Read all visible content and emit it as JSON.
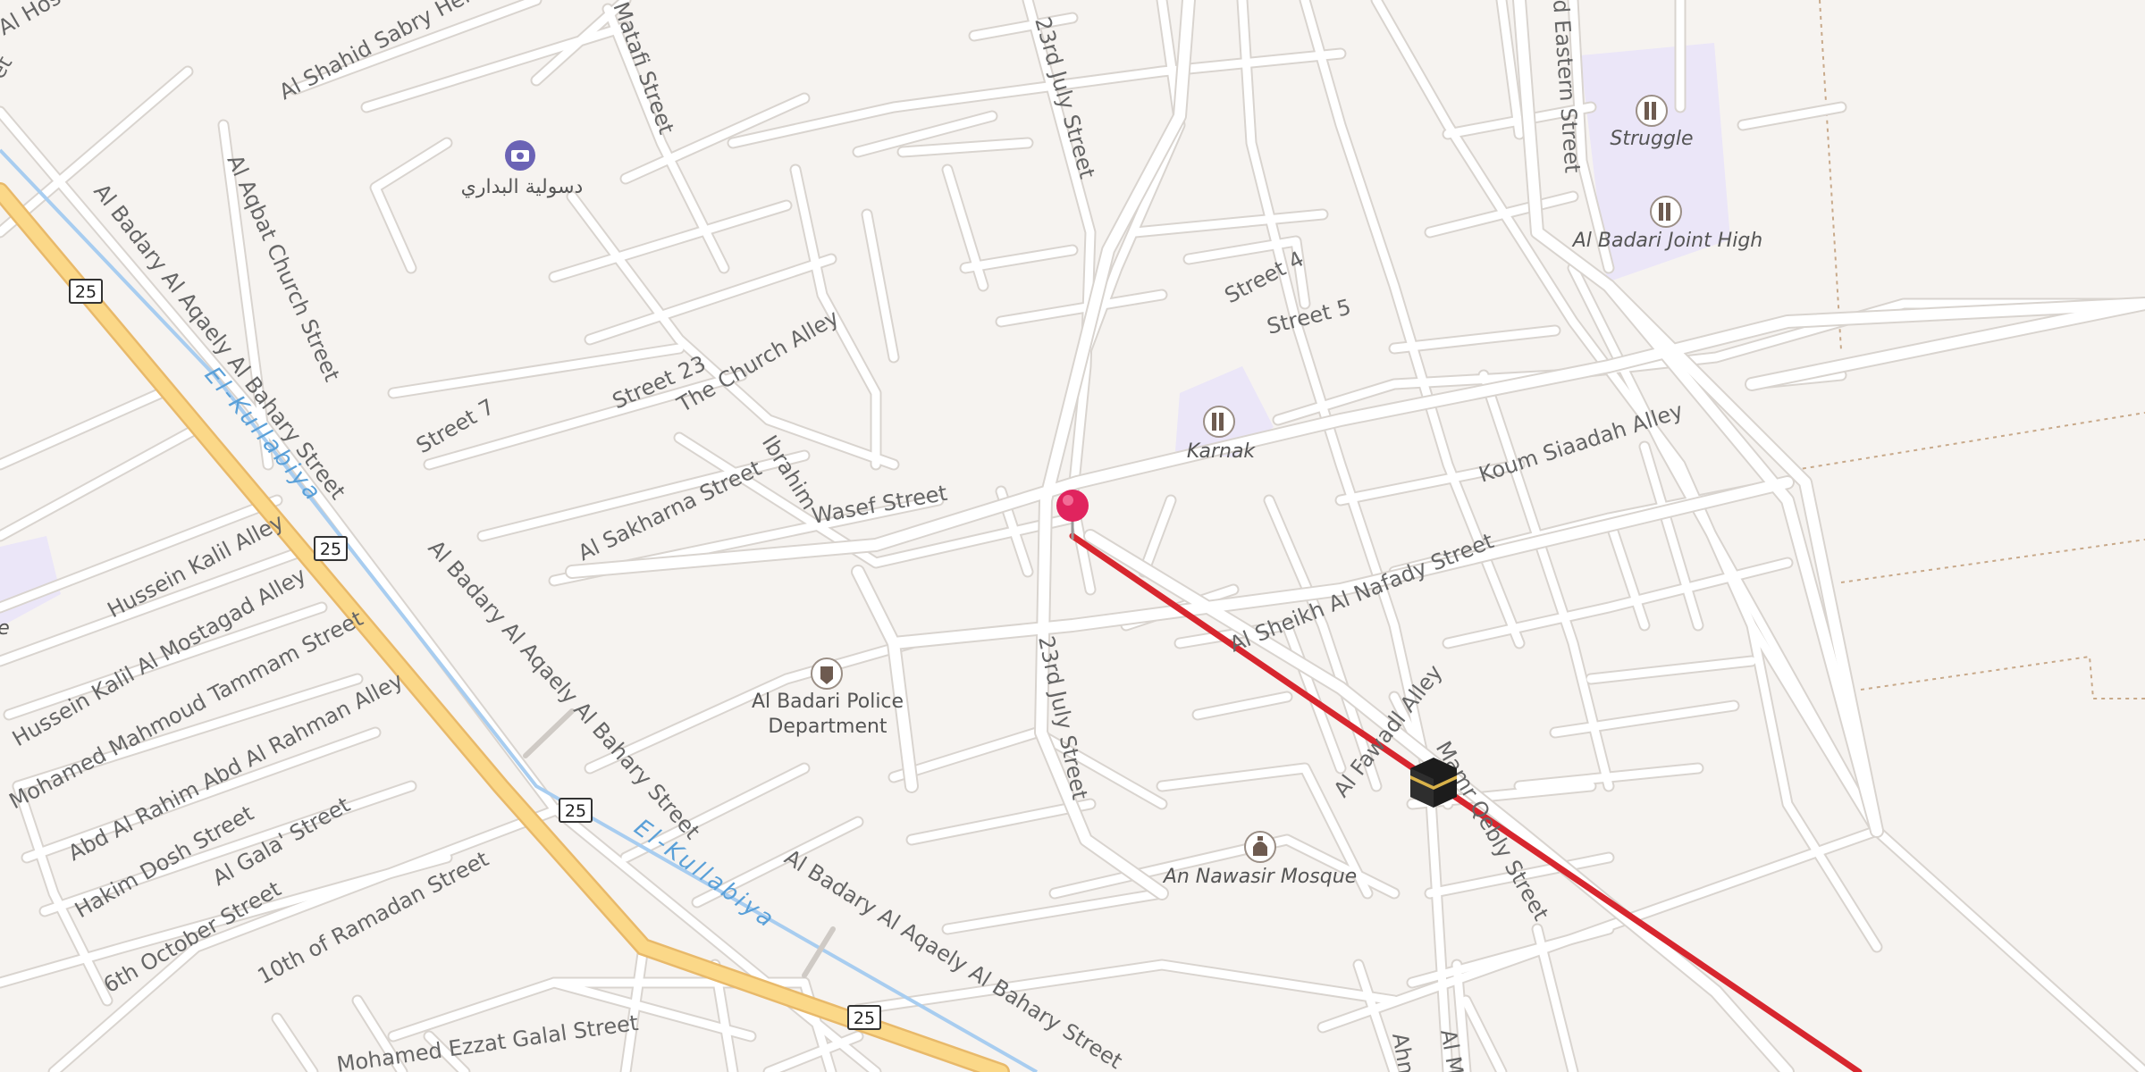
{
  "colors": {
    "background": "#f6f3f0",
    "road": "#ffffff",
    "road_casing": "#d9d4cf",
    "highway": "#fbd888",
    "highway_casing": "#e8b96a",
    "water": "#a8cdf0",
    "school_area": "#ebe6f8",
    "route_line": "#d7262e",
    "pin": "#e0245e",
    "boundary": "#c8a98a"
  },
  "streets": {
    "shahid_sabry": "Al Shahid Sabry Henry Street",
    "al_hos": "Al Hos",
    "matafi": "Matafi Street",
    "july23_north": "23rd July Street",
    "eastern": "d Eastern Street",
    "badary_aqaely_1": "Al Badary Al Aqaely Al Bahary Street",
    "aqbat_church": "Al Aqbat Church Street",
    "street4": "Street 4",
    "street5": "Street 5",
    "church_alley": "The Church Alley",
    "street23": "Street 23",
    "street7": "Street 7",
    "ibrahim_wasef_a": "Ibrahim",
    "ibrahim_wasef_b": "Wasef Street",
    "sakharna": "Al Sakharna Street",
    "koum_siaadah": "Koum Siaadah Alley",
    "sheikh_nafady": "Al Sheikh Al Nafady Street",
    "hussein_kalil": "Hussein Kalil Alley",
    "hussein_kalil_mostagad": "Hussein Kalil Al Mostagad Alley",
    "mohamed_tammam": "Mohamed Mahmoud Tammam Street",
    "abd_rahim": "Abd Al Rahim Abd Al Rahman Alley",
    "hakim_dosh": "Hakim Dosh Street",
    "gala": "Al Gala' Street",
    "october6": "6th October Street",
    "ramadan10": "10th of Ramadan Street",
    "badary_aqaely_2": "Al Badary Al Aqaely Al Bahary Street",
    "badary_aqaely_3": "Al Badary Al Aqaely Al Bahary Street",
    "july23_south": "23rd July Street",
    "fawadi": "Al Fawadl Alley",
    "qebly": "Mamr Qebly Street",
    "ezzat_galal": "Mohamed Ezzat Galal Street",
    "ahm": "Ahm",
    "al_m": "Al M",
    "street_tail": "et"
  },
  "waterway": {
    "name_1": "El-Kullabiya",
    "name_2": "El-Kullabiya"
  },
  "highway_shields": [
    "25",
    "25",
    "25",
    "25"
  ],
  "pois": {
    "photo_spot": {
      "label": "دسولية البداري",
      "icon": "camera-icon"
    },
    "struggle": {
      "label": "Struggle",
      "icon": "school-icon"
    },
    "badari_joint_high": {
      "label": "Al Badari Joint High",
      "icon": "school-icon"
    },
    "karnak": {
      "label": "Karnak",
      "icon": "school-icon"
    },
    "police": {
      "label_line1": "Al Badari Police",
      "label_line2": "Department",
      "icon": "police-icon"
    },
    "mosque": {
      "label": "An Nawasir Mosque",
      "icon": "mosque-icon"
    },
    "left_edge": {
      "label": "e",
      "icon": "school-icon"
    }
  },
  "markers": {
    "pin": {
      "icon": "map-pin-icon"
    },
    "kaaba": {
      "icon": "kaaba-icon"
    }
  }
}
